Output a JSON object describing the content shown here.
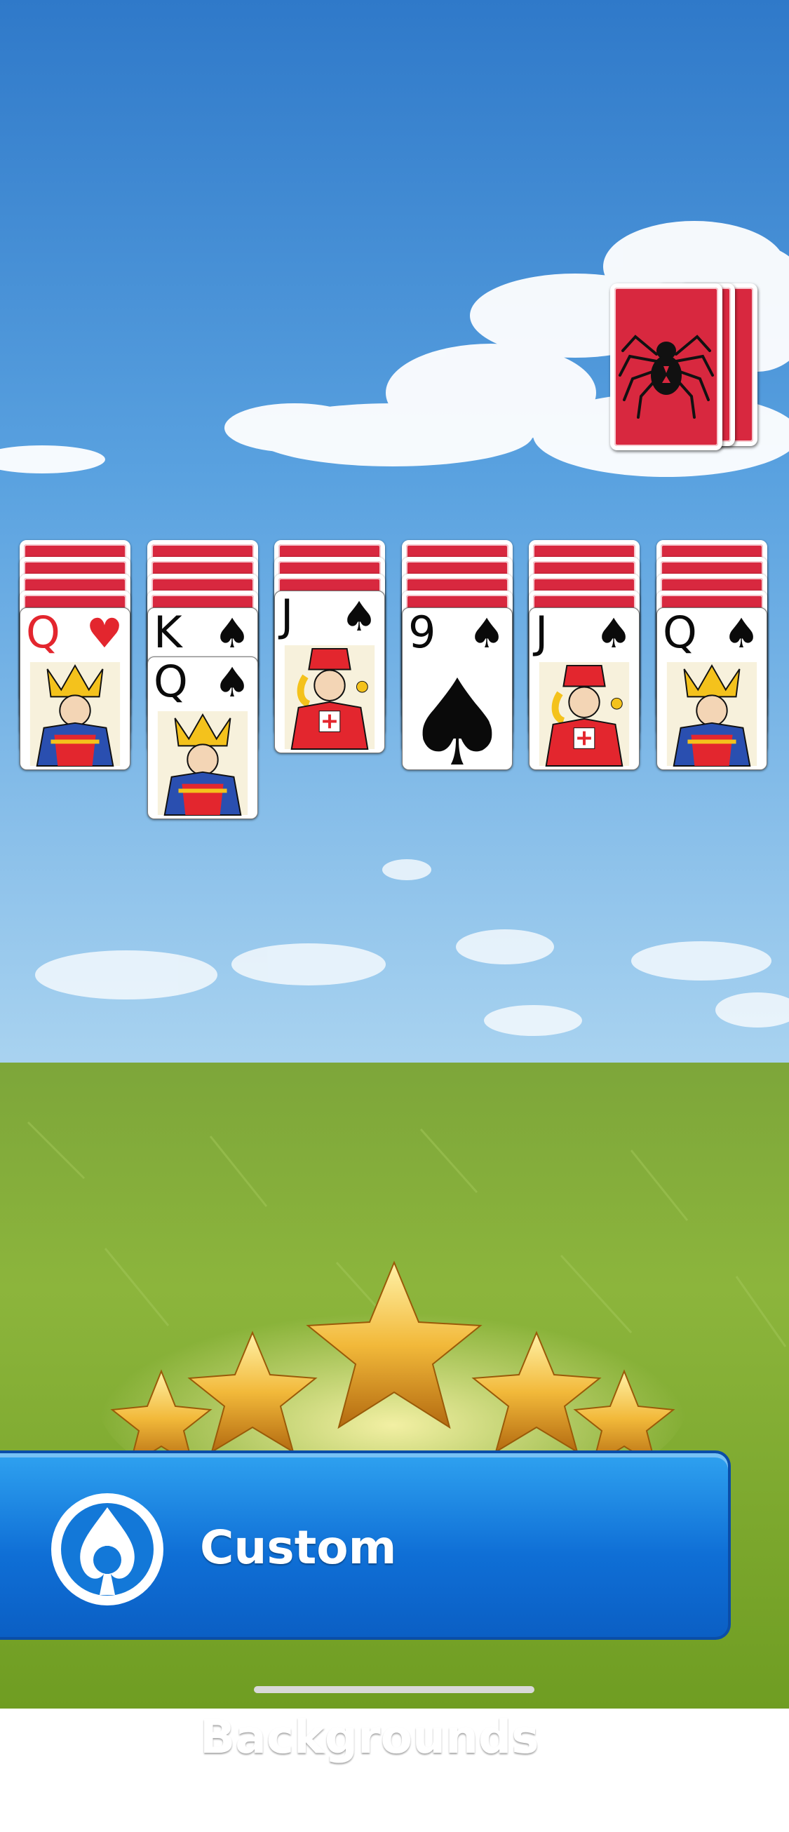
{
  "game": "Spider Solitaire",
  "colors": {
    "card_back": "#d8283f",
    "red_suit": "#e3262e",
    "black_suit": "#0a0a0a",
    "banner_blue": "#0f6fd6",
    "sky": "#3f8fd8",
    "grass": "#7aa32a"
  },
  "stock": {
    "cards_remaining_piles": 3,
    "back_icon": "spider-icon"
  },
  "tableau": [
    {
      "hidden": 4,
      "face_up": [
        {
          "rank": "Q",
          "suit": "♥",
          "color": "red",
          "art": "queen"
        }
      ]
    },
    {
      "hidden": 4,
      "face_up": [
        {
          "rank": "K",
          "suit": "♠",
          "color": "black",
          "art": "none"
        },
        {
          "rank": "Q",
          "suit": "♠",
          "color": "black",
          "art": "queen"
        }
      ]
    },
    {
      "hidden": 3,
      "face_up": [
        {
          "rank": "J",
          "suit": "♠",
          "color": "black",
          "art": "jack"
        }
      ]
    },
    {
      "hidden": 4,
      "face_up": [
        {
          "rank": "9",
          "suit": "♠",
          "color": "black",
          "art": "pip"
        }
      ]
    },
    {
      "hidden": 4,
      "face_up": [
        {
          "rank": "J",
          "suit": "♠",
          "color": "black",
          "art": "jack"
        }
      ]
    },
    {
      "hidden": 4,
      "face_up": [
        {
          "rank": "Q",
          "suit": "♠",
          "color": "black",
          "art": "queen"
        }
      ]
    }
  ],
  "banner": {
    "title": "Custom Backgrounds",
    "icon": "app-logo-icon"
  }
}
